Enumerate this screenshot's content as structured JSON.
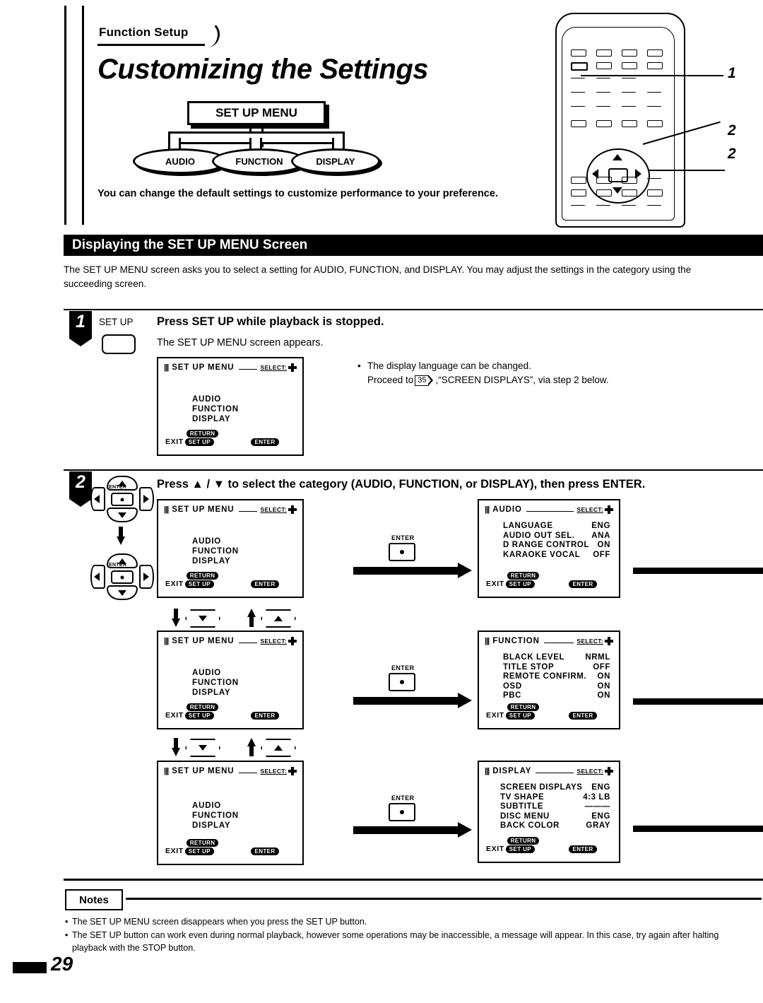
{
  "header": {
    "kicker": "Function Setup",
    "title": "Customizing the Settings",
    "intro": "You can change the default settings to customize performance to your preference."
  },
  "diagram": {
    "root_label": "SET UP MENU",
    "branches": [
      "AUDIO",
      "FUNCTION",
      "DISPLAY"
    ]
  },
  "remote": {
    "callouts": [
      "1",
      "2",
      "2"
    ]
  },
  "section": {
    "bar_title": "Displaying the SET UP MENU Screen",
    "description": "The SET UP MENU screen asks you to select a setting for AUDIO, FUNCTION, and DISPLAY.  You may adjust the settings in the category using the succeeding screen."
  },
  "steps": [
    {
      "number": "1",
      "key_label": "SET UP",
      "heading": "Press SET UP while playback is stopped.",
      "subtext": "The SET UP MENU screen appears.",
      "side_note_line1": "The display language can be changed.",
      "side_note_line2_pre": "Proceed to",
      "side_note_badge": "35",
      "side_note_line2_post": ",“SCREEN DISPLAYS”, via step 2 below."
    },
    {
      "number": "2",
      "heading": "Press ▲ / ▼ to select the category (AUDIO, FUNCTION, or DISPLAY), then press ENTER.",
      "enter_label": "ENTER"
    }
  ],
  "osd_screens": {
    "setup_menu": {
      "title": "SET UP MENU",
      "select_label": "SELECT:",
      "items": [
        "AUDIO",
        "FUNCTION",
        "DISPLAY"
      ],
      "exit_label": "EXIT",
      "return_pill": "RETURN",
      "setup_pill": "SET UP",
      "enter_pill": "ENTER"
    },
    "audio": {
      "title": "AUDIO",
      "select_label": "SELECT:",
      "rows": [
        {
          "name": "LANGUAGE",
          "value": "ENG"
        },
        {
          "name": "AUDIO OUT SEL.",
          "value": "ANA"
        },
        {
          "name": "D RANGE CONTROL",
          "value": "ON"
        },
        {
          "name": "KARAOKE VOCAL",
          "value": "OFF"
        }
      ],
      "exit_label": "EXIT",
      "return_pill": "RETURN",
      "setup_pill": "SET UP",
      "enter_pill": "ENTER"
    },
    "function": {
      "title": "FUNCTION",
      "select_label": "SELECT:",
      "rows": [
        {
          "name": "BLACK LEVEL",
          "value": "NRML"
        },
        {
          "name": "TITLE STOP",
          "value": "OFF"
        },
        {
          "name": "REMOTE CONFIRM.",
          "value": "ON"
        },
        {
          "name": "OSD",
          "value": "ON"
        },
        {
          "name": "PBC",
          "value": "ON"
        }
      ],
      "exit_label": "EXIT",
      "return_pill": "RETURN",
      "setup_pill": "SET UP",
      "enter_pill": "ENTER"
    },
    "display": {
      "title": "DISPLAY",
      "select_label": "SELECT:",
      "rows": [
        {
          "name": "SCREEN DISPLAYS",
          "value": "ENG"
        },
        {
          "name": "TV SHAPE",
          "value": "4:3 LB"
        },
        {
          "name": "SUBTITLE",
          "value": "———"
        },
        {
          "name": "DISC MENU",
          "value": "ENG"
        },
        {
          "name": "BACK COLOR",
          "value": "GRAY"
        }
      ],
      "exit_label": "EXIT",
      "return_pill": "RETURN",
      "setup_pill": "SET UP",
      "enter_pill": "ENTER"
    }
  },
  "notes": {
    "title": "Notes",
    "items": [
      "The SET UP MENU screen disappears when you press the SET UP button.",
      "The SET UP button can work even during normal playback, however some operations may be inaccessible, a message will appear. In this case, try again after halting playback with the STOP button."
    ]
  },
  "footer": {
    "page_number": "29"
  }
}
